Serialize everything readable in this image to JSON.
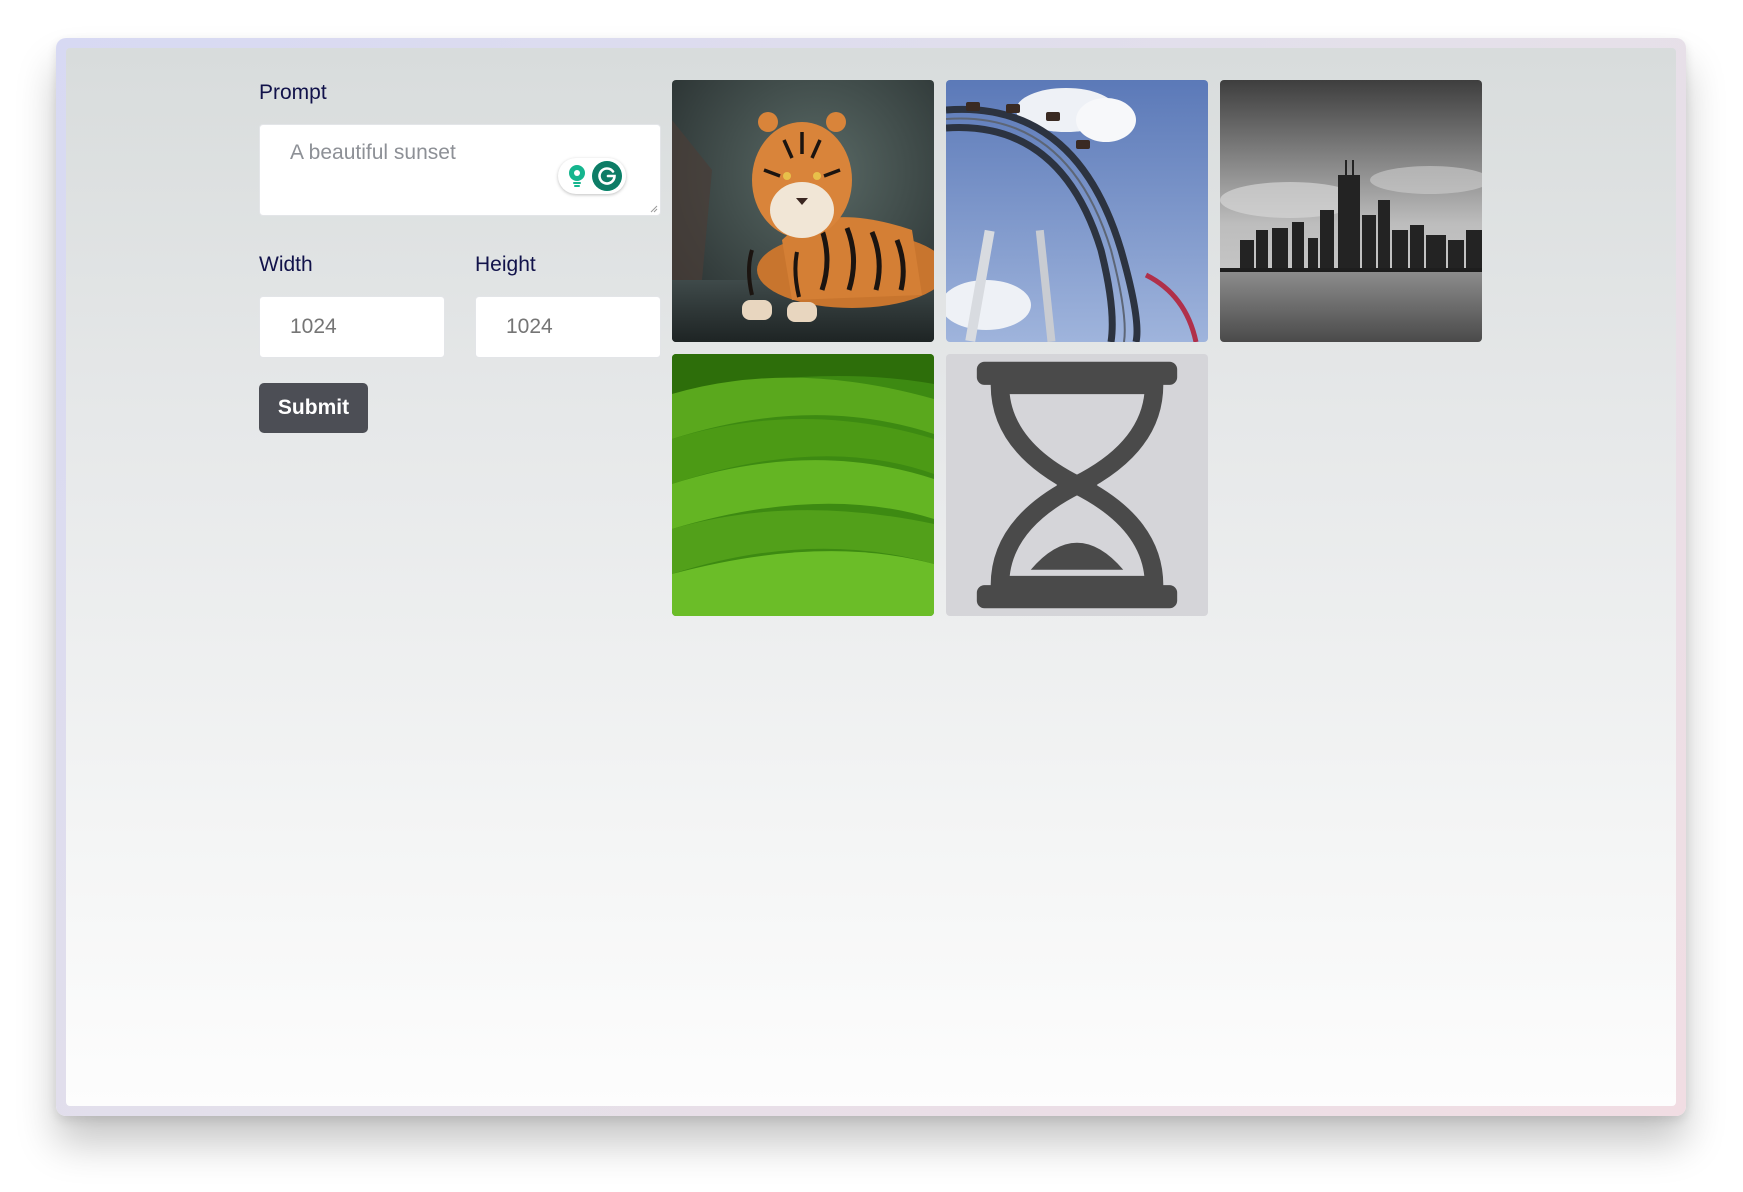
{
  "form": {
    "prompt_label": "Prompt",
    "prompt_placeholder": "A beautiful sunset",
    "width_label": "Width",
    "width_placeholder": "1024",
    "height_label": "Height",
    "height_placeholder": "1024",
    "submit_label": "Submit"
  },
  "gallery": {
    "images": [
      {
        "subject": "tiger lying in water",
        "status": "done"
      },
      {
        "subject": "roller coaster loop against blue sky",
        "status": "done"
      },
      {
        "subject": "black and white city skyline over lake",
        "status": "done"
      },
      {
        "subject": "rolling green hills",
        "status": "done"
      },
      {
        "subject": "pending generation",
        "status": "loading",
        "icon": "hourglass-icon"
      }
    ]
  },
  "extensions": {
    "grammarly_icon": "grammarly-icon",
    "assist_icon": "lightbulb-icon"
  },
  "colors": {
    "label": "#11124a",
    "submit_bg": "#4c4e55",
    "placeholder_tile": "#d5d5d9"
  }
}
